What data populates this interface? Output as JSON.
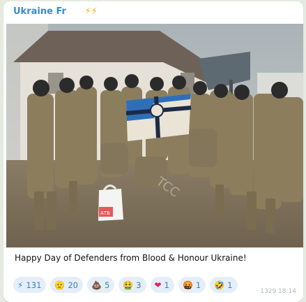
{
  "message": {
    "channel_name": "Ukraine Fr",
    "channel_emoji": "⚡⚡",
    "caption": "Happy Day of Defenders from Blood & Honour Ukraine!",
    "photo": {
      "icon": "group-photo",
      "bag_label": "АТБ",
      "watermark": "TCC"
    },
    "reactions": [
      {
        "emoji": "⚡",
        "icon": "lightning-icon",
        "count": "131"
      },
      {
        "emoji": "🫡",
        "icon": "salute-icon",
        "count": "20"
      },
      {
        "emoji": "💩",
        "icon": "poop-icon",
        "count": "5"
      },
      {
        "emoji": "🤮",
        "icon": "vomit-icon",
        "count": "3"
      },
      {
        "emoji": "❤",
        "icon": "heart-icon",
        "count": "1"
      },
      {
        "emoji": "🤬",
        "icon": "angry-icon",
        "count": "1"
      },
      {
        "emoji": "🤣",
        "icon": "laugh-icon",
        "count": "1"
      }
    ],
    "meta": "· 1329  18:14"
  },
  "colors": {
    "accent": "#3a8ec9",
    "reaction_bg": "#e4eef9",
    "background": "#e6ebe2"
  }
}
